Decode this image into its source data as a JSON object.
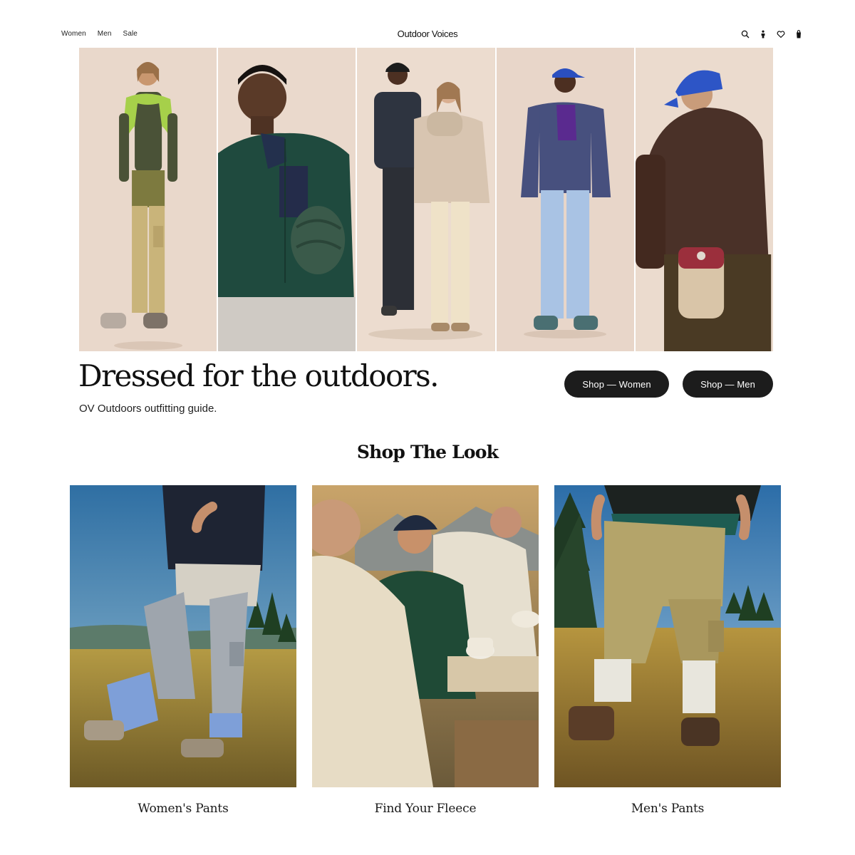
{
  "header": {
    "nav": [
      {
        "label": "Women"
      },
      {
        "label": "Men"
      },
      {
        "label": "Sale"
      }
    ],
    "brand": "Outdoor Voices",
    "icons": [
      "search-icon",
      "account-icon",
      "wishlist-icon",
      "cart-icon"
    ]
  },
  "hero": {
    "headline": "Dressed for the outdoors.",
    "subhead": "OV Outdoors outfitting guide.",
    "cta_women": "Shop — Women",
    "cta_men": "Shop — Men"
  },
  "shop_the_look": {
    "title": "Shop The Look",
    "cards": [
      {
        "label": "Women's Pants"
      },
      {
        "label": "Find Your Fleece"
      },
      {
        "label": "Men's Pants"
      }
    ]
  },
  "colors": {
    "background": "#ffffff",
    "hero_backdrop": "#e9d9cd",
    "button": "#1c1c1c",
    "text": "#111111"
  }
}
